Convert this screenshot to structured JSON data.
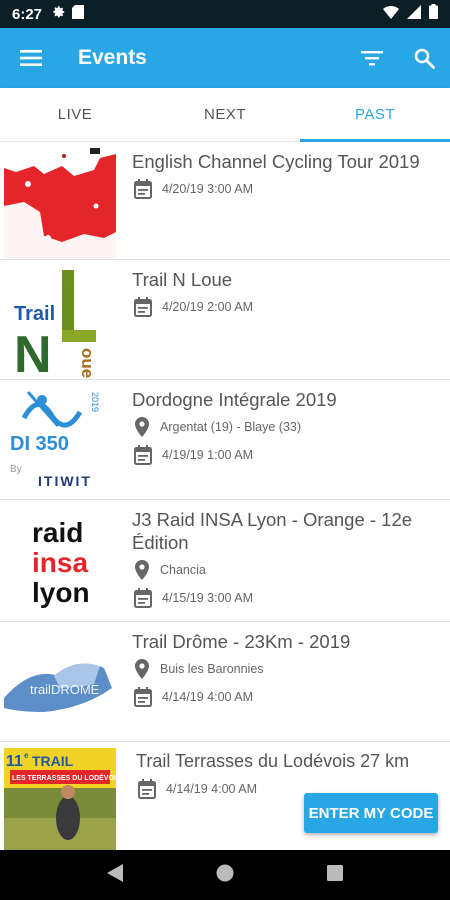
{
  "status_bar": {
    "time": "6:27"
  },
  "app_bar": {
    "title": "Events",
    "accent_color": "#29a7e5"
  },
  "tabs": [
    {
      "label": "LIVE",
      "active": false
    },
    {
      "label": "NEXT",
      "active": false
    },
    {
      "label": "PAST",
      "active": true
    }
  ],
  "events": [
    {
      "title": "English Channel Cycling Tour 2019",
      "location": "",
      "date": "4/20/19 3:00 AM"
    },
    {
      "title": "Trail N Loue",
      "location": "",
      "date": "4/20/19 2:00 AM",
      "logo_text": {
        "trail": "Trail",
        "n": "N",
        "l": "L",
        "oue": "oue"
      }
    },
    {
      "title": "Dordogne Intégrale 2019",
      "location": "Argentat (19) - Blaye (33)",
      "date": "4/19/19 1:00 AM",
      "logo_text": {
        "year": "2019",
        "main": "DI 350",
        "by": "By",
        "brand": "ITIWIT"
      }
    },
    {
      "title": "J3 Raid INSA Lyon - Orange - 12e Édition",
      "location": "Chancia",
      "date": "4/15/19 3:00 AM",
      "logo_text": {
        "l1": "raid",
        "l2": "insa",
        "l3": "lyon"
      }
    },
    {
      "title": "Trail Drôme - 23Km - 2019",
      "location": "Buis les Baronnies",
      "date": "4/14/19 4:00 AM",
      "logo_text": {
        "main": "trailDROME"
      }
    },
    {
      "title": "Trail Terrasses du Lodévois 27 km",
      "location": "",
      "date": "4/14/19 4:00 AM",
      "logo_text": {
        "num": "11",
        "sup": "e",
        "trail": "TRAIL",
        "banner": "LES TERRASSES DU LODÉVOIS"
      }
    }
  ],
  "fab": {
    "label": "ENTER MY CODE"
  }
}
